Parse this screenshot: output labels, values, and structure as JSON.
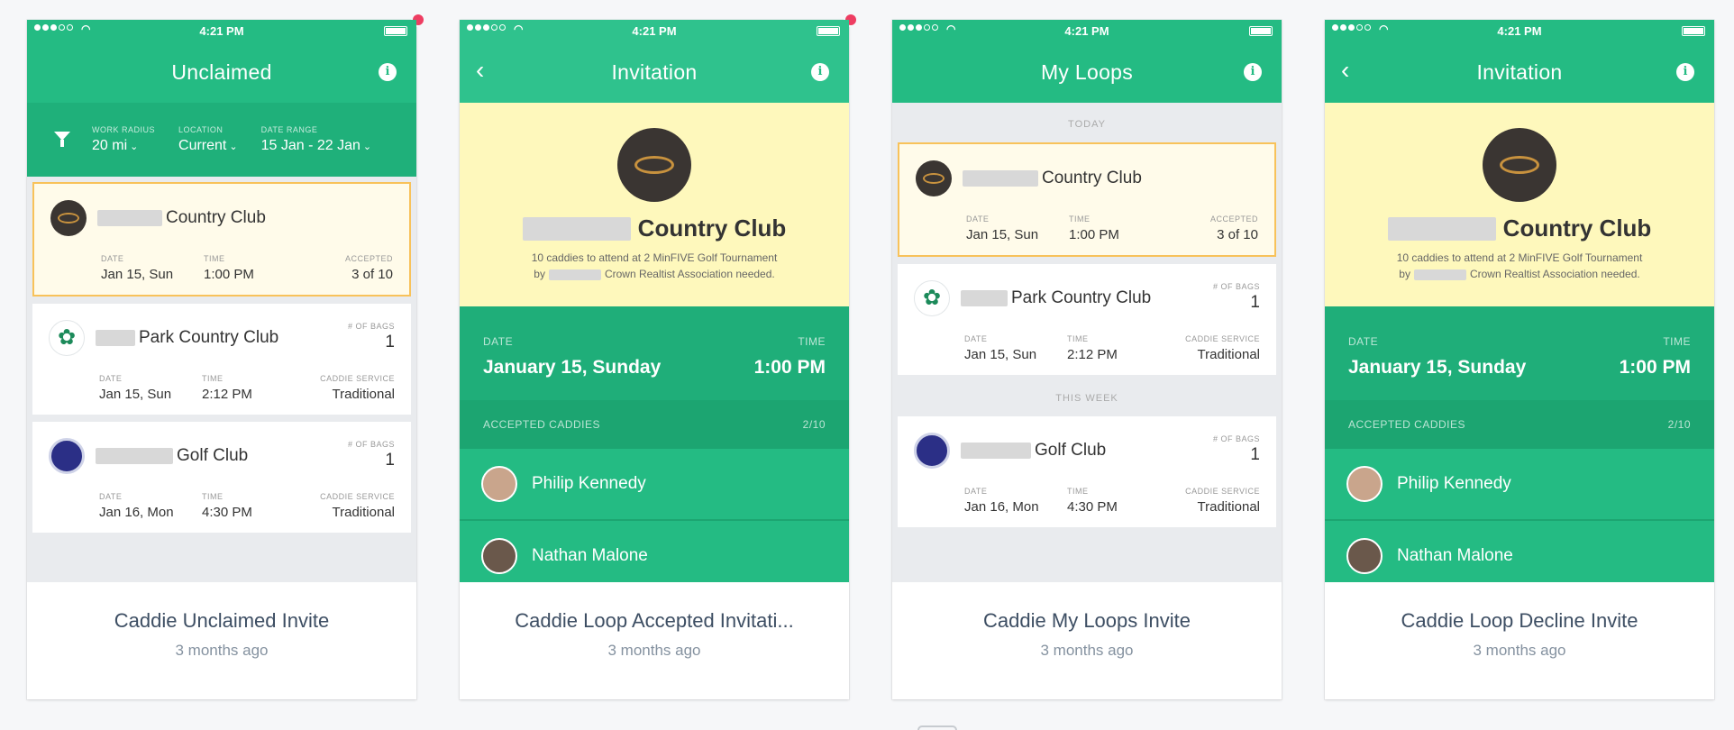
{
  "status": {
    "time": "4:21 PM"
  },
  "screens": [
    {
      "nav_title": "Unclaimed",
      "filters": [
        {
          "label": "WORK RADIUS",
          "value": "20 mi"
        },
        {
          "label": "LOCATION",
          "value": "Current"
        },
        {
          "label": "DATE RANGE",
          "value": "15 Jan - 22 Jan"
        }
      ],
      "items": [
        {
          "name": "Country Club",
          "date_label": "DATE",
          "date": "Jan 15, Sun",
          "time_label": "TIME",
          "time": "1:00 PM",
          "third_label": "ACCEPTED",
          "third": "3 of 10"
        },
        {
          "name": "Park Country Club",
          "bags_label": "# OF BAGS",
          "bags": "1",
          "date_label": "DATE",
          "date": "Jan 15, Sun",
          "time_label": "TIME",
          "time": "2:12 PM",
          "third_label": "CADDIE SERVICE",
          "third": "Traditional"
        },
        {
          "name": "Golf Club",
          "bags_label": "# OF BAGS",
          "bags": "1",
          "date_label": "DATE",
          "date": "Jan 16, Mon",
          "time_label": "TIME",
          "time": "4:30 PM",
          "third_label": "CADDIE SERVICE",
          "third": "Traditional"
        }
      ],
      "caption": "Caddie Unclaimed Invite",
      "ago": "3 months ago"
    },
    {
      "nav_title": "Invitation",
      "club": "Country Club",
      "desc_a": "10 caddies to attend at 2 MinFIVE Golf Tournament",
      "desc_b_pre": "by",
      "desc_b_post": "Crown Realtist Association needed.",
      "date_label": "DATE",
      "date": "January 15, Sunday",
      "time_label": "TIME",
      "time": "1:00 PM",
      "accepted_label": "ACCEPTED CADDIES",
      "accepted_count": "2/10",
      "caddies": [
        "Philip Kennedy",
        "Nathan Malone"
      ],
      "caption": "Caddie Loop Accepted Invitati...",
      "ago": "3 months ago"
    },
    {
      "nav_title": "My Loops",
      "section_today": "TODAY",
      "section_week": "THIS WEEK",
      "items": [
        {
          "name": "Country Club",
          "date_label": "DATE",
          "date": "Jan 15, Sun",
          "time_label": "TIME",
          "time": "1:00 PM",
          "third_label": "ACCEPTED",
          "third": "3 of 10"
        },
        {
          "name": "Park Country Club",
          "bags_label": "# OF BAGS",
          "bags": "1",
          "date_label": "DATE",
          "date": "Jan 15, Sun",
          "time_label": "TIME",
          "time": "2:12 PM",
          "third_label": "CADDIE SERVICE",
          "third": "Traditional"
        },
        {
          "name": "Golf Club",
          "bags_label": "# OF BAGS",
          "bags": "1",
          "date_label": "DATE",
          "date": "Jan 16, Mon",
          "time_label": "TIME",
          "time": "4:30 PM",
          "third_label": "CADDIE SERVICE",
          "third": "Traditional"
        }
      ],
      "caption": "Caddie My Loops Invite",
      "ago": "3 months ago"
    },
    {
      "nav_title": "Invitation",
      "club": "Country Club",
      "desc_a": "10 caddies to attend at 2 MinFIVE Golf Tournament",
      "desc_b_pre": "by",
      "desc_b_post": "Crown Realtist Association needed.",
      "date_label": "DATE",
      "date": "January 15, Sunday",
      "time_label": "TIME",
      "time": "1:00 PM",
      "accepted_label": "ACCEPTED CADDIES",
      "accepted_count": "2/10",
      "caddies": [
        "Philip Kennedy",
        "Nathan Malone"
      ],
      "caption": "Caddie Loop Decline Invite",
      "ago": "3 months ago"
    }
  ],
  "icons": {
    "info": "i",
    "back": "‹",
    "chevron": "⌄"
  },
  "colors": {
    "brand_green": "#24bb83",
    "highlight_yellow": "#fef8bc",
    "notify_red": "#ee3d62",
    "selected_border": "#f8c25a"
  }
}
